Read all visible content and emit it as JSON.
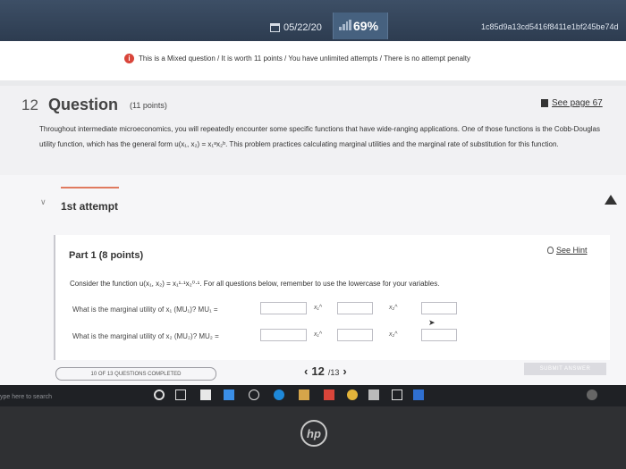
{
  "topbar": {
    "date": "05/22/20",
    "progress": "69%",
    "hash": "1c85d9a13cd5416f8411e1bf245be74d"
  },
  "info": {
    "text": "This is a Mixed question / It is worth 11 points / You have unlimited attempts / There is no attempt penalty"
  },
  "question": {
    "number": "12",
    "title": "Question",
    "points": "(11 points)",
    "see_page": "See page 67",
    "text": "Throughout intermediate microeconomics, you will repeatedly encounter some specific functions that have wide-ranging applications. One of those functions is the Cobb-Douglas utility function, which has the general form u(x₁, x₂) = x₁ᵃx₂ᵇ. This problem practices calculating marginal utilities and the marginal rate of substitution for this function."
  },
  "attempt": {
    "label": "1st attempt"
  },
  "part": {
    "title": "Part 1  (8 points)",
    "hint": "See Hint",
    "consider": "Consider the function u(x₁, x₂) = x₁¹·¹x₂⁰·¹. For all questions below, remember to use the lowercase for your variables.",
    "q1_label": "What is the marginal utility of x₁ (MU₁)? MU₁ =",
    "q2_label": "What is the marginal utility of x₂ (MU₂)? MU₂ =",
    "x1_caret": "x₁^",
    "x2_caret": "x₂^"
  },
  "footer": {
    "completed": "10 OF 13 QUESTIONS COMPLETED",
    "page_current": "12",
    "page_total": "/13",
    "prev": "‹",
    "next": "›",
    "submit": "SUBMIT ANSWER"
  },
  "taskbar": {
    "search": "ype here to search"
  },
  "bezel": {
    "logo": "hp"
  }
}
